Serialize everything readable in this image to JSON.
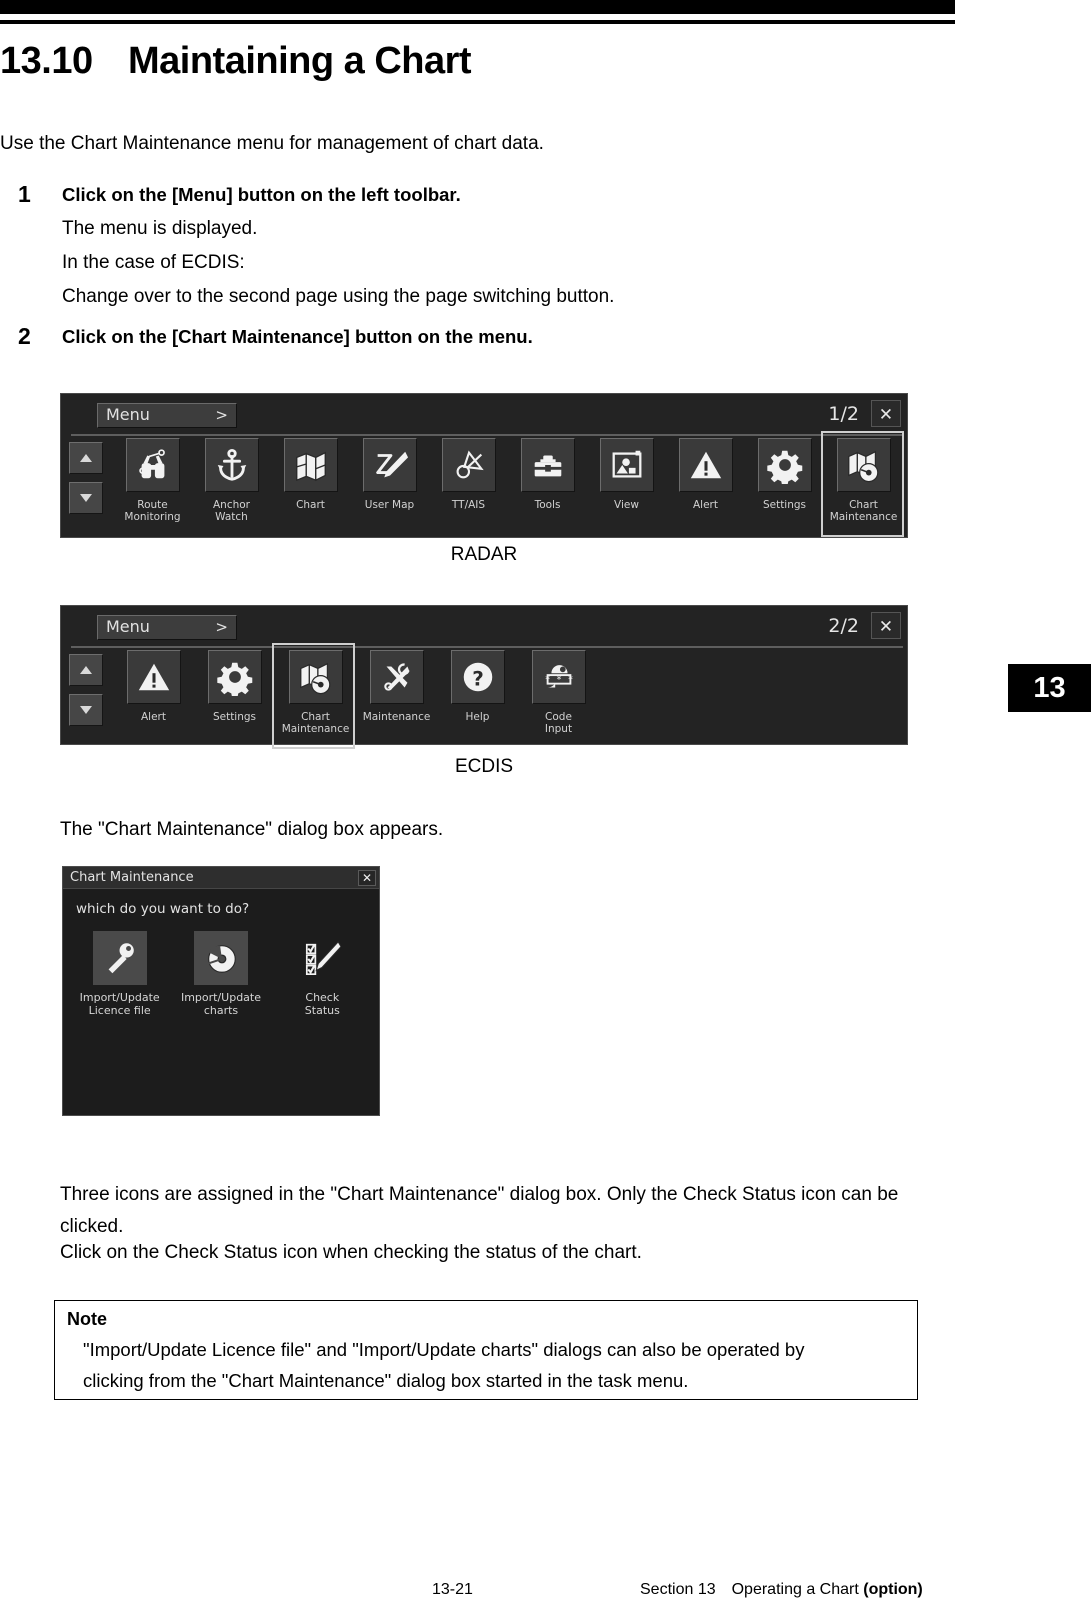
{
  "header": {
    "section_number": "13.10",
    "title": "Maintaining a Chart",
    "intro": "Use the Chart Maintenance menu for management of chart data."
  },
  "steps": [
    {
      "number": "1",
      "title": "Click on the [Menu] button on the left toolbar.",
      "lines": [
        "The menu is displayed.",
        "In the case of ECDIS:",
        "Change over to the second page using the page switching button."
      ]
    },
    {
      "number": "2",
      "title": "Click on the [Chart Maintenance] button on the menu.",
      "lines": []
    }
  ],
  "radar_menu": {
    "menu_button_label": "Menu",
    "menu_button_chevron": ">",
    "page_indicator": "1/2",
    "close_icon": "✕",
    "scroll_up_icon": "triangle-up-icon",
    "scroll_down_icon": "triangle-down-icon",
    "items": [
      {
        "label": "Route\nMonitoring",
        "icon": "binoculars-icon",
        "selected": false
      },
      {
        "label": "Anchor\nWatch",
        "icon": "anchor-icon",
        "selected": false
      },
      {
        "label": "Chart",
        "icon": "folded-map-icon",
        "selected": false
      },
      {
        "label": "User Map",
        "icon": "pen-zigzag-icon",
        "selected": false
      },
      {
        "label": "TT/AIS",
        "icon": "target-tracking-icon",
        "selected": false
      },
      {
        "label": "Tools",
        "icon": "toolbox-icon",
        "selected": false
      },
      {
        "label": "View",
        "icon": "view-window-icon",
        "selected": false
      },
      {
        "label": "Alert",
        "icon": "warning-triangle-icon",
        "selected": false
      },
      {
        "label": "Settings",
        "icon": "gear-icon",
        "selected": false
      },
      {
        "label": "Chart\nMaintenance",
        "icon": "chart-maintenance-icon",
        "selected": true
      }
    ],
    "caption": "RADAR"
  },
  "ecdis_menu": {
    "menu_button_label": "Menu",
    "menu_button_chevron": ">",
    "page_indicator": "2/2",
    "close_icon": "✕",
    "scroll_up_icon": "triangle-up-icon",
    "scroll_down_icon": "triangle-down-icon",
    "items": [
      {
        "label": "Alert",
        "icon": "warning-triangle-icon",
        "selected": false
      },
      {
        "label": "Settings",
        "icon": "gear-icon",
        "selected": false
      },
      {
        "label": "Chart\nMaintenance",
        "icon": "chart-maintenance-icon",
        "selected": true
      },
      {
        "label": "Maintenance",
        "icon": "wrench-screwdriver-icon",
        "selected": false
      },
      {
        "label": "Help",
        "icon": "question-mark-icon",
        "selected": false
      },
      {
        "label": "Code\nInput",
        "icon": "code-input-icon",
        "selected": false
      }
    ],
    "caption": "ECDIS"
  },
  "dialog_intro": "The \"Chart Maintenance\" dialog box appears.",
  "chart_maintenance_dialog": {
    "title": "Chart Maintenance",
    "close_icon": "✕",
    "question": "which do you want to do?",
    "items": [
      {
        "label": "Import/Update\nLicence file",
        "icon": "key-icon",
        "enabled": false
      },
      {
        "label": "Import/Update\ncharts",
        "icon": "disc-icon",
        "enabled": false
      },
      {
        "label": "Check\nStatus",
        "icon": "checklist-pen-icon",
        "enabled": true
      }
    ]
  },
  "body_paragraphs": [
    "Three icons are assigned in the \"Chart Maintenance\" dialog box. Only the Check Status icon can be clicked.",
    "Click on the Check Status icon when checking the status of the chart."
  ],
  "note": {
    "heading": "Note",
    "lines": [
      "\"Import/Update Licence file\" and \"Import/Update charts\" dialogs can also be operated by",
      "clicking from the \"Chart Maintenance\" dialog box started in the task menu."
    ]
  },
  "chapter_tab": "13",
  "footer": {
    "page_number": "13-21",
    "section_prefix": "Section 13 Operating a Chart ",
    "section_suffix": "(option)"
  }
}
